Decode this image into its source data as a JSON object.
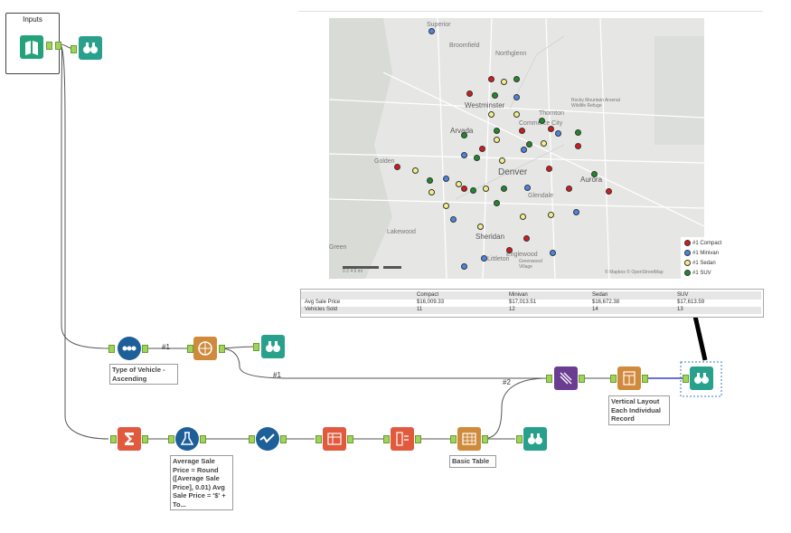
{
  "container": {
    "title": "Inputs"
  },
  "annotations": {
    "sort": "Type of Vehicle - Ascending",
    "formula": "Average Sale Price = Round ([Average Sale Price], 0.01) Avg Sale Price = '$' + To...",
    "layout": "Vertical Layout Each Individual Record",
    "table": "Basic Table"
  },
  "connections": {
    "c1": "#1",
    "c2": "#1",
    "c3": "#2"
  },
  "map": {
    "labels": {
      "superior": "Superior",
      "broomfield": "Broomfield",
      "northglenn": "Northglenn",
      "westminster": "Westminster",
      "thornton": "Thornton",
      "commerce_city": "Commerce City",
      "arvada": "Arvada",
      "denver": "Denver",
      "aurora": "Aurora",
      "golden": "Golden",
      "sheridan": "Sheridan",
      "littleton": "Littleton",
      "englewood": "Englewood",
      "greenwood_village": "Greenwood Village",
      "wildlife": "Rocky Mountain Arsenal Wildlife Refuge",
      "lakewood": "Lakewood",
      "glendale": "Glendale",
      "green": "Green",
      "attribution": "© Mapbox © OpenStreetMap"
    },
    "legend": [
      {
        "label": "#1   Compact",
        "color": "#d7191c"
      },
      {
        "label": "#1   Minivan",
        "color": "#4a86e8"
      },
      {
        "label": "#1   Sedan",
        "color": "#f5ef8a"
      },
      {
        "label": "#1   SUV",
        "color": "#1f8a2a"
      }
    ],
    "scale": "0    2    4    6 mi"
  },
  "table": {
    "headers": [
      "",
      "Compact",
      "Minivan",
      "Sedan",
      "SUV"
    ],
    "rows": [
      [
        "Avg Sale Price",
        "$16,009.33",
        "$17,013.51",
        "$16,672.38",
        "$17,613.59"
      ],
      [
        "Vehicles Sold",
        "11",
        "12",
        "14",
        "13"
      ]
    ]
  },
  "tools": [
    {
      "id": "input",
      "name": "input-data-tool-icon",
      "color": "#24a37a"
    },
    {
      "id": "browse1",
      "name": "browse-tool-icon",
      "color": "#28a08c"
    },
    {
      "id": "sort",
      "name": "sort-tool-icon",
      "color": "#1e5f9a"
    },
    {
      "id": "spatial",
      "name": "create-points-tool-icon",
      "color": "#d08a3c"
    },
    {
      "id": "browse2",
      "name": "browse-tool-icon",
      "color": "#28a08c"
    },
    {
      "id": "summarize",
      "name": "summarize-tool-icon",
      "color": "#e15a3e"
    },
    {
      "id": "formula",
      "name": "formula-tool-icon",
      "color": "#1e5f9a"
    },
    {
      "id": "select",
      "name": "select-tool-icon",
      "color": "#1e5f9a"
    },
    {
      "id": "crosstab",
      "name": "cross-tab-tool-icon",
      "color": "#e15a3e"
    },
    {
      "id": "transpose",
      "name": "transpose-tool-icon",
      "color": "#e15a3e"
    },
    {
      "id": "table",
      "name": "table-tool-icon",
      "color": "#d08a3c"
    },
    {
      "id": "browse3",
      "name": "browse-tool-icon",
      "color": "#28a08c"
    },
    {
      "id": "join",
      "name": "join-multiple-tool-icon",
      "color": "#6a3d91"
    },
    {
      "id": "layout",
      "name": "layout-tool-icon",
      "color": "#d08a3c"
    },
    {
      "id": "browse4",
      "name": "browse-tool-icon",
      "color": "#28a08c"
    }
  ]
}
